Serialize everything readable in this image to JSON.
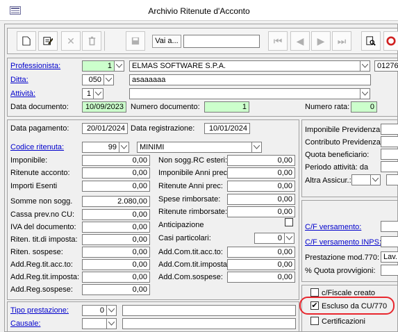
{
  "window": {
    "title": "Archivio Ritenute d'Acconto"
  },
  "toolbar": {
    "goto_label": "Vai a...",
    "goto_value": ""
  },
  "header": {
    "professionista_label": "Professionista:",
    "professionista_code": "1",
    "professionista_name": "ELMAS SOFTWARE S.P.A.",
    "professionista_extra": "01276",
    "ditta_label": "Ditta:",
    "ditta_code": "050",
    "ditta_name": "asaaaaaa",
    "attivita_label": "Attività:",
    "attivita_code": "1",
    "attivita_name": "",
    "data_documento_label": "Data documento:",
    "data_documento": "10/09/2023",
    "numero_documento_label": "Numero documento:",
    "numero_documento": "1",
    "numero_rata_label": "Numero rata:",
    "numero_rata": "0"
  },
  "details": {
    "data_pagamento_label": "Data pagamento:",
    "data_pagamento": "20/01/2024",
    "data_registrazione_label": "Data registrazione:",
    "data_registrazione": "10/01/2024",
    "codice_ritenuta_label": "Codice ritenuta:",
    "codice_ritenuta": "99",
    "codice_ritenuta_desc": "MINIMI",
    "left_rows": [
      {
        "label": "Imponibile:",
        "value": "0,00"
      },
      {
        "label": "Ritenute acconto:",
        "value": "0,00"
      },
      {
        "label": "Importi Esenti",
        "value": "0,00"
      },
      {
        "label": "Somme non sogg.",
        "value": "2.080,00"
      },
      {
        "label": "Cassa prev.no CU:",
        "value": "0,00"
      },
      {
        "label": "IVA del documento:",
        "value": "0,00"
      },
      {
        "label": "Riten. tit.di imposta:",
        "value": "0,00"
      },
      {
        "label": "Riten. sospese:",
        "value": "0,00"
      },
      {
        "label": "Add.Reg.tit.acc.to:",
        "value": "0,00"
      },
      {
        "label": "Add.Reg.tit.imposta:",
        "value": "0,00"
      },
      {
        "label": "Add.Reg.sospese:",
        "value": "0,00"
      }
    ],
    "right_rows": [
      {
        "label": "Non sogg.RC esteri:",
        "value": "0,00"
      },
      {
        "label": "Imponibile Anni prec:",
        "value": "0,00"
      },
      {
        "label": "Ritenute  Anni prec:",
        "value": "0,00"
      },
      {
        "label": "Spese rimborsate:",
        "value": "0,00"
      },
      {
        "label": "Ritenute rimborsate:",
        "value": "0,00"
      }
    ],
    "anticipazione_label": "Anticipazione",
    "casi_particolari_label": "Casi particolari:",
    "casi_particolari_value": "0",
    "right_rows2": [
      {
        "label": "Add.Com.tit.acc.to:",
        "value": "0,00"
      },
      {
        "label": "Add.Com.tit.imposta:",
        "value": "0,00"
      },
      {
        "label": "Add.Com.sospese:",
        "value": "0,00"
      }
    ],
    "tipo_prestazione_label": "Tipo prestazione:",
    "tipo_prestazione_value": "0",
    "causale_label": "Causale:"
  },
  "side": {
    "rows": [
      "Imponibile Previdenza:",
      "Contributo Previdenza:",
      "Quota beneficiario:",
      "Periodo attività: da"
    ],
    "altra_assicur_label": "Altra Assicur.:",
    "cf_versamento_label": "C/F versamento:",
    "cf_versamento_inps_label": "C/F versamento INPS:",
    "prestazione_label": "Prestazione mod.770:",
    "prestazione_value": "Lav.",
    "quota_provvigioni_label": "% Quota provvigioni:",
    "checkboxes": [
      {
        "label": "c/Fiscale creato",
        "checked": false
      },
      {
        "label": "Escluso da CU/770",
        "checked": true
      },
      {
        "label": "Certificazioni",
        "checked": false
      }
    ]
  },
  "colors": {
    "highlight": "#e8262d",
    "field_green": "#ccffcc",
    "link": "#0000cc"
  }
}
